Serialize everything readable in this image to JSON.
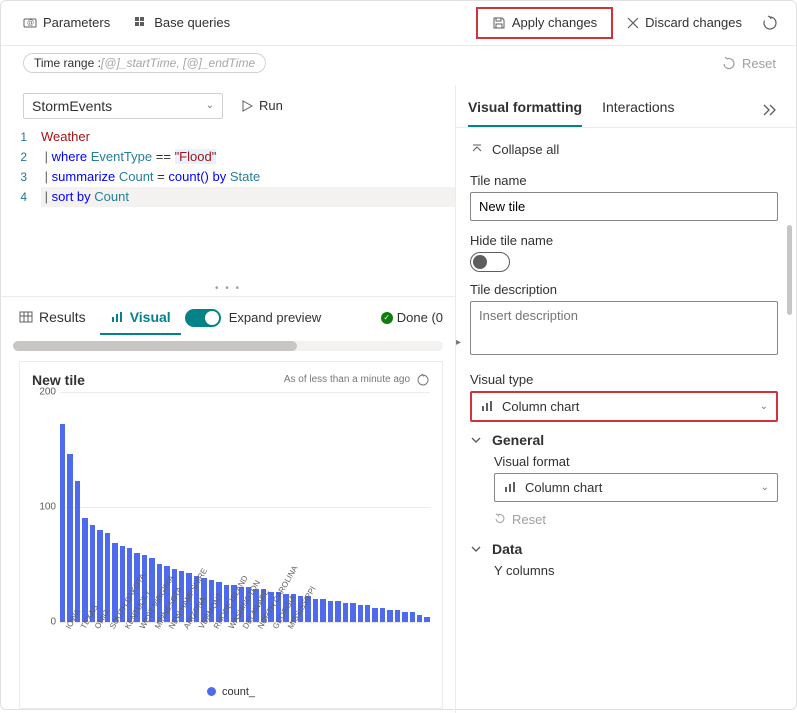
{
  "topbar": {
    "parameters": "Parameters",
    "base_queries": "Base queries",
    "apply_changes": "Apply changes",
    "discard_changes": "Discard changes"
  },
  "timebar": {
    "label": "Time range : ",
    "value": "[@]_startTime, [@]_endTime",
    "reset": "Reset"
  },
  "query": {
    "source": "StormEvents",
    "run": "Run",
    "lines": {
      "l1": "Weather",
      "l2_where": "where",
      "l2_col": "EventType",
      "l2_eq": "==",
      "l2_val": "\"Flood\"",
      "l3_sum": "summarize",
      "l3_count_var": "Count",
      "l3_eq": "=",
      "l3_count_fn": "count()",
      "l3_by": "by",
      "l3_state": "State",
      "l4_sort": "sort by",
      "l4_col": "Count"
    }
  },
  "results": {
    "tab_results": "Results",
    "tab_visual": "Visual",
    "expand_preview": "Expand preview",
    "done": "Done (0"
  },
  "chart": {
    "title": "New tile",
    "subtitle": "As of less than a minute ago",
    "legend": "count_"
  },
  "chart_data": {
    "type": "bar",
    "title": "New tile",
    "xlabel": "",
    "ylabel": "",
    "ylim": [
      0,
      200
    ],
    "y_ticks": [
      0,
      100,
      200
    ],
    "series": [
      {
        "name": "count_",
        "values": [
          172,
          146,
          122,
          90,
          84,
          80,
          77,
          68,
          66,
          64,
          60,
          58,
          55,
          50,
          48,
          46,
          44,
          42,
          40,
          38,
          36,
          34,
          32,
          32,
          30,
          30,
          28,
          28,
          26,
          26,
          24,
          24,
          22,
          22,
          20,
          20,
          18,
          18,
          16,
          16,
          14,
          14,
          12,
          12,
          10,
          10,
          8,
          8,
          6,
          4
        ]
      }
    ],
    "categories": [
      "IOWA",
      "TEXAS",
      "",
      "OHIO",
      "",
      "SOUTH DAKOTA",
      "",
      "KENTUCKY",
      "",
      "WEST VIRGINIA",
      "",
      "MINNESOTA",
      "",
      "NEW HAMPSHIRE",
      "",
      "ARIZONA",
      "",
      "VERMONT",
      "",
      "RHODE ISLAND",
      "",
      "WASHINGTON",
      "",
      "DELAWARE",
      "",
      "NORTH CAROLINA",
      "",
      "GEORGIA",
      "",
      "MISSISSIPPI",
      "",
      "",
      "",
      "",
      "",
      "",
      "",
      "",
      "",
      "",
      "",
      "",
      "",
      "",
      "",
      "",
      "",
      "",
      "",
      ""
    ],
    "visible_categories": [
      "IOWA",
      "TEXAS",
      "OHIO",
      "SOUTH DAKOTA",
      "KENTUCKY",
      "WEST VIRGINIA",
      "MINNESOTA",
      "NEW HAMPSHIRE",
      "ARIZONA",
      "VERMONT",
      "RHODE ISLAND",
      "WASHINGTON",
      "DELAWARE",
      "NORTH CAROLINA",
      "GEORGIA",
      "MISSISSIPPI"
    ]
  },
  "right_panel": {
    "tab_visual_formatting": "Visual formatting",
    "tab_interactions": "Interactions",
    "collapse_all": "Collapse all",
    "tile_name_label": "Tile name",
    "tile_name_value": "New tile",
    "hide_tile_name": "Hide tile name",
    "tile_description_label": "Tile description",
    "tile_description_placeholder": "Insert description",
    "visual_type_label": "Visual type",
    "visual_type_value": "Column chart",
    "section_general": "General",
    "visual_format_label": "Visual format",
    "visual_format_value": "Column chart",
    "reset": "Reset",
    "section_data": "Data",
    "y_columns": "Y columns"
  }
}
